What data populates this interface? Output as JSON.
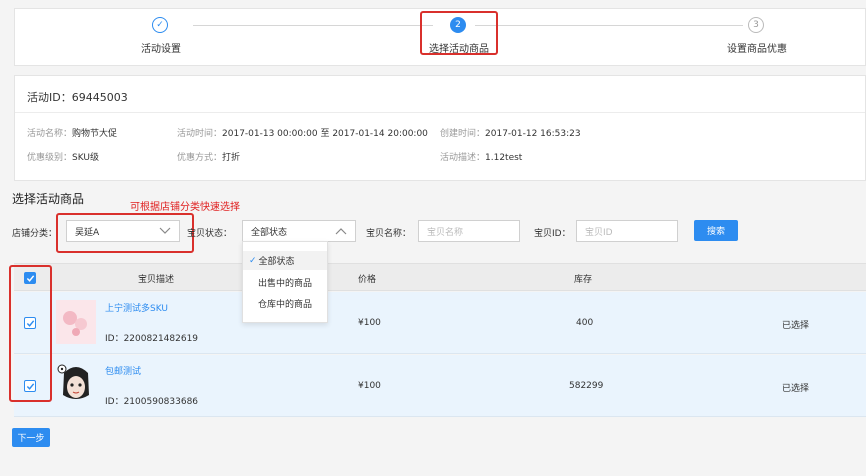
{
  "steps": [
    {
      "label": "活动设置",
      "state": "done",
      "marker": "✓"
    },
    {
      "label": "选择活动商品",
      "state": "active",
      "marker": "2"
    },
    {
      "label": "设置商品优惠",
      "state": "todo",
      "marker": "3"
    }
  ],
  "activity": {
    "id_text": "活动ID：69445003",
    "name_label": "活动名称：",
    "name_value": "购物节大促",
    "time_label": "活动时间：",
    "time_value": "2017-01-13 00:00:00 至 2017-01-14 20:00:00",
    "created_label": "创建时间：",
    "created_value": "2017-01-12 16:53:23",
    "level_label": "优惠级别：",
    "level_value": "SKU级",
    "method_label": "优惠方式：",
    "method_value": "打折",
    "desc_label": "活动描述：",
    "desc_value": "1.12test"
  },
  "section": {
    "title": "选择活动商品",
    "hint": "可根据店铺分类快速选择"
  },
  "filters": {
    "shop_category_label": "店铺分类：",
    "shop_category_value": "吴延A",
    "status_label": "宝贝状态：",
    "status_value": "全部状态",
    "name_label": "宝贝名称：",
    "name_placeholder": "宝贝名称",
    "id_label": "宝贝ID：",
    "id_placeholder": "宝贝ID",
    "search_button": "搜索"
  },
  "status_options": [
    "全部状态",
    "出售中的商品",
    "仓库中的商品"
  ],
  "table": {
    "headers": {
      "desc": "宝贝描述",
      "price": "价格",
      "stock": "库存"
    },
    "rows": [
      {
        "name": "上宁测试多SKU",
        "id_text": "ID：2200821482619",
        "price": "¥100",
        "stock": "400",
        "status": "已选择"
      },
      {
        "name": "包邮测试",
        "id_text": "ID：2100590833686",
        "price": "¥100",
        "stock": "582299",
        "status": "已选择"
      }
    ]
  },
  "next_button": "下一步",
  "colors": {
    "primary": "#2d8cf0",
    "annotation": "#d9302c",
    "hint": "#e02020"
  }
}
